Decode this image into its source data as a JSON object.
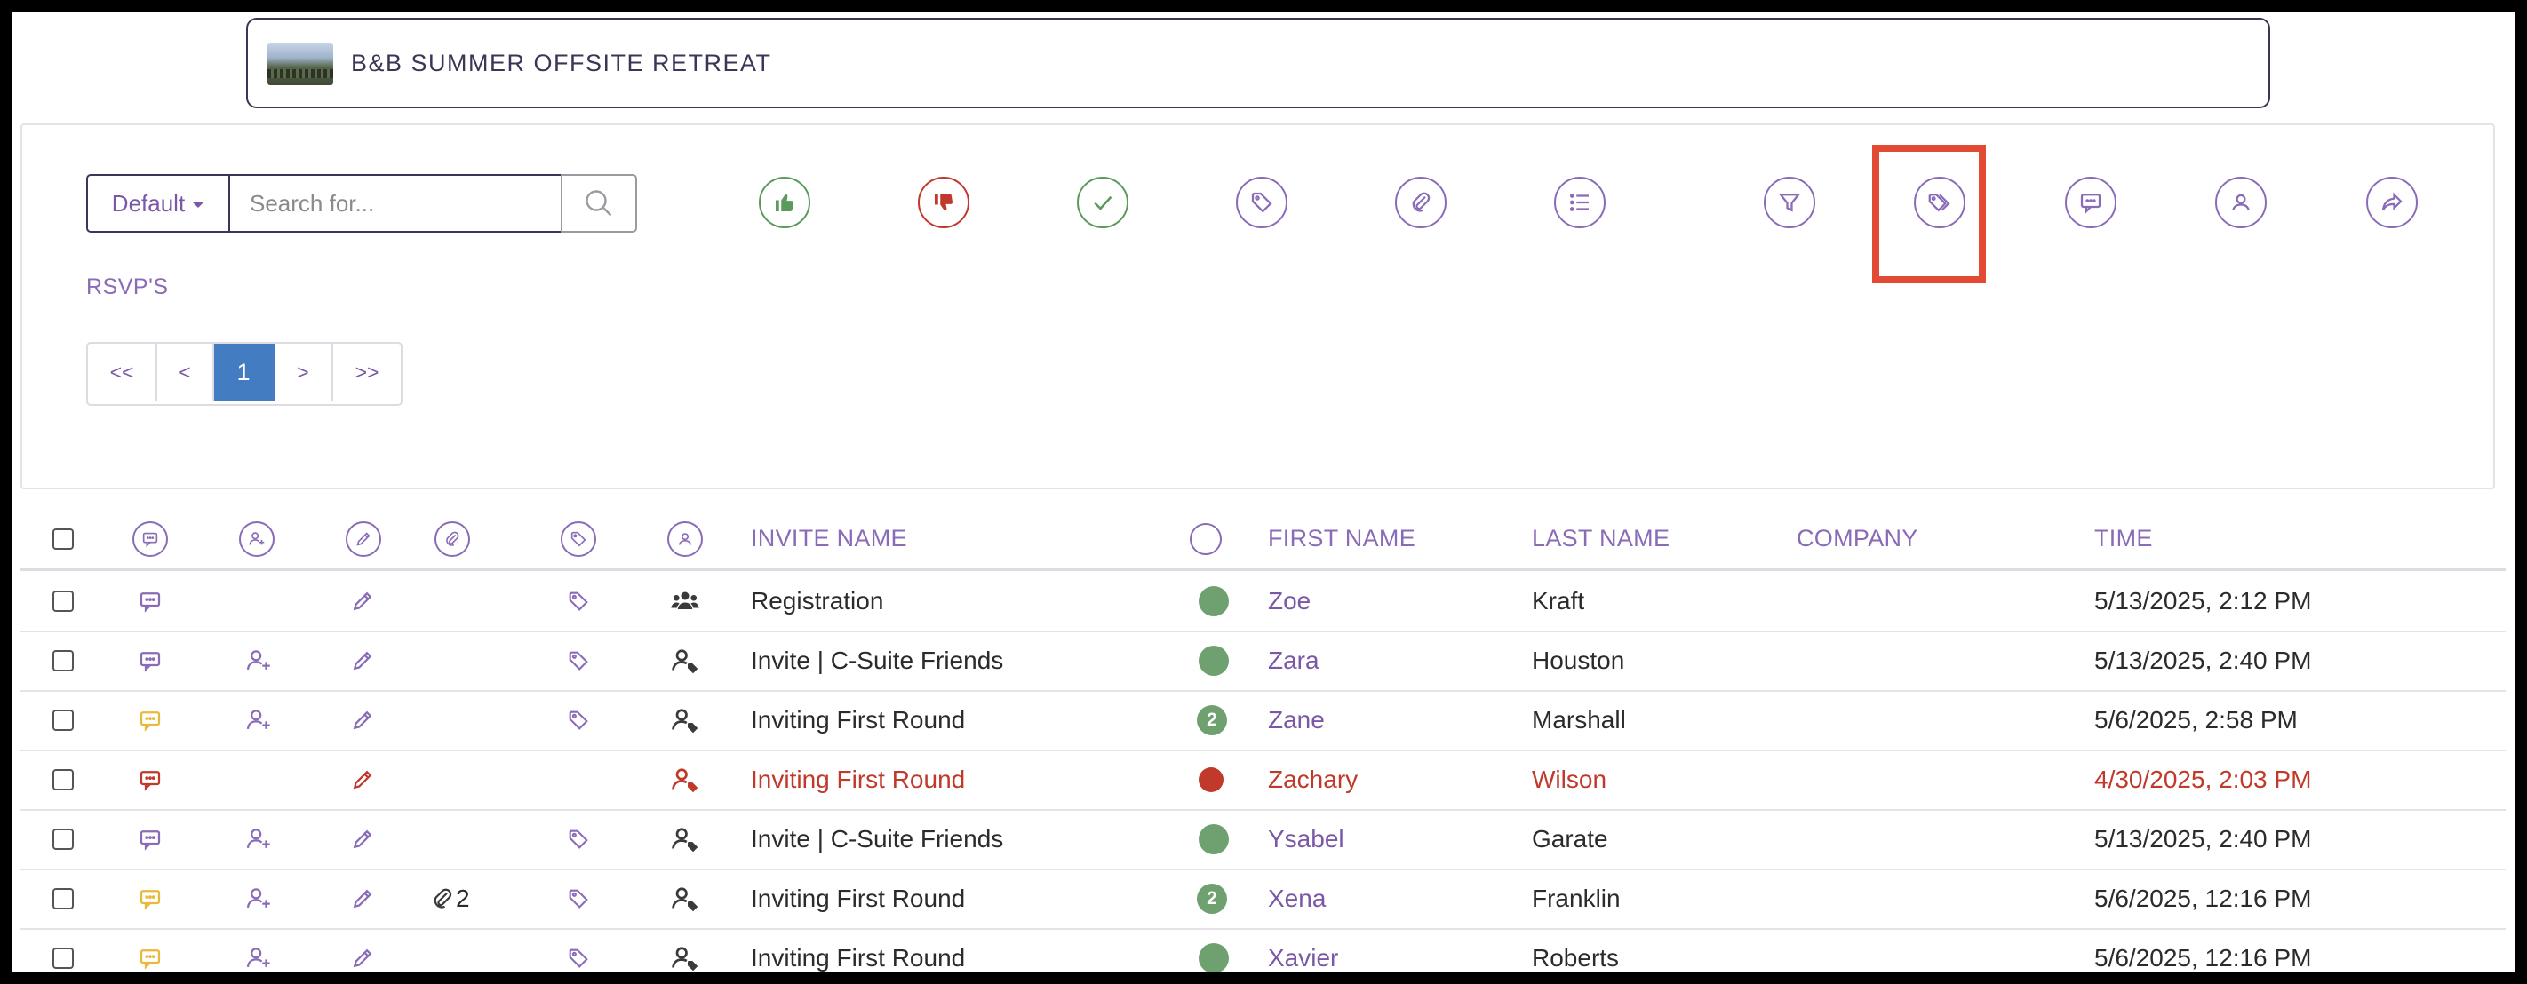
{
  "event": {
    "title": "B&B SUMMER OFFSITE RETREAT"
  },
  "toolbar": {
    "default_label": "Default",
    "search_placeholder": "Search for...",
    "rsvp_label": "RSVP'S",
    "icons": [
      {
        "name": "thumbs-up-icon",
        "color": "#5a9a5a"
      },
      {
        "name": "thumbs-down-icon",
        "color": "#c0392b"
      },
      {
        "name": "check-icon",
        "color": "#5a9a5a"
      },
      {
        "name": "tag-icon",
        "color": "#8a6bb8"
      },
      {
        "name": "paperclip-icon",
        "color": "#8a6bb8"
      },
      {
        "name": "list-icon",
        "color": "#8a6bb8"
      },
      {
        "name": "filter-icon",
        "color": "#8a6bb8"
      },
      {
        "name": "tags-icon",
        "color": "#8a6bb8",
        "highlighted": true
      },
      {
        "name": "comment-icon",
        "color": "#8a6bb8"
      },
      {
        "name": "user-icon",
        "color": "#8a6bb8"
      },
      {
        "name": "share-icon",
        "color": "#8a6bb8"
      }
    ]
  },
  "pagination": {
    "first": "<<",
    "prev": "<",
    "current": "1",
    "next": ">",
    "last": ">>"
  },
  "table": {
    "headers": {
      "invite_name": "INVITE NAME",
      "first_name": "FIRST NAME",
      "last_name": "LAST NAME",
      "company": "COMPANY",
      "time": "TIME"
    },
    "rows": [
      {
        "comment": "#8a6bb8",
        "add_user": false,
        "edit": "#8a6bb8",
        "attach": "",
        "tag": true,
        "person": "group",
        "invite": "Registration",
        "status": "#6fa06f",
        "status_num": "",
        "first": "Zoe",
        "last": "Kraft",
        "company": "",
        "time": "5/13/2025, 2:12 PM",
        "alert": false
      },
      {
        "comment": "#8a6bb8",
        "add_user": true,
        "edit": "#8a6bb8",
        "attach": "",
        "tag": true,
        "person": "user-tag",
        "invite": "Invite | C-Suite Friends",
        "status": "#6fa06f",
        "status_num": "",
        "first": "Zara",
        "last": "Houston",
        "company": "",
        "time": "5/13/2025, 2:40 PM",
        "alert": false
      },
      {
        "comment": "#e8b93a",
        "add_user": true,
        "edit": "#8a6bb8",
        "attach": "",
        "tag": true,
        "person": "user-tag",
        "invite": "Inviting First Round",
        "status": "#6fa06f",
        "status_num": "2",
        "first": "Zane",
        "last": "Marshall",
        "company": "",
        "time": "5/6/2025, 2:58 PM",
        "alert": false
      },
      {
        "comment": "#c0392b",
        "add_user": false,
        "edit": "#c0392b",
        "attach": "",
        "tag": false,
        "person": "user-tag",
        "invite": "Inviting First Round",
        "status": "#c0392b",
        "status_num": "",
        "first": "Zachary",
        "last": "Wilson",
        "company": "",
        "time": "4/30/2025, 2:03 PM",
        "alert": true
      },
      {
        "comment": "#8a6bb8",
        "add_user": true,
        "edit": "#8a6bb8",
        "attach": "",
        "tag": true,
        "person": "user-tag",
        "invite": "Invite | C-Suite Friends",
        "status": "#6fa06f",
        "status_num": "",
        "first": "Ysabel",
        "last": "Garate",
        "company": "",
        "time": "5/13/2025, 2:40 PM",
        "alert": false
      },
      {
        "comment": "#e8b93a",
        "add_user": true,
        "edit": "#8a6bb8",
        "attach": "2",
        "tag": true,
        "person": "user-tag",
        "invite": "Inviting First Round",
        "status": "#6fa06f",
        "status_num": "2",
        "first": "Xena",
        "last": "Franklin",
        "company": "",
        "time": "5/6/2025, 12:16 PM",
        "alert": false
      },
      {
        "comment": "#e8b93a",
        "add_user": true,
        "edit": "#8a6bb8",
        "attach": "",
        "tag": true,
        "person": "user-tag",
        "invite": "Inviting First Round",
        "status": "#6fa06f",
        "status_num": "",
        "first": "Xavier",
        "last": "Roberts",
        "company": "",
        "time": "5/6/2025, 12:16 PM",
        "alert": false
      }
    ]
  }
}
